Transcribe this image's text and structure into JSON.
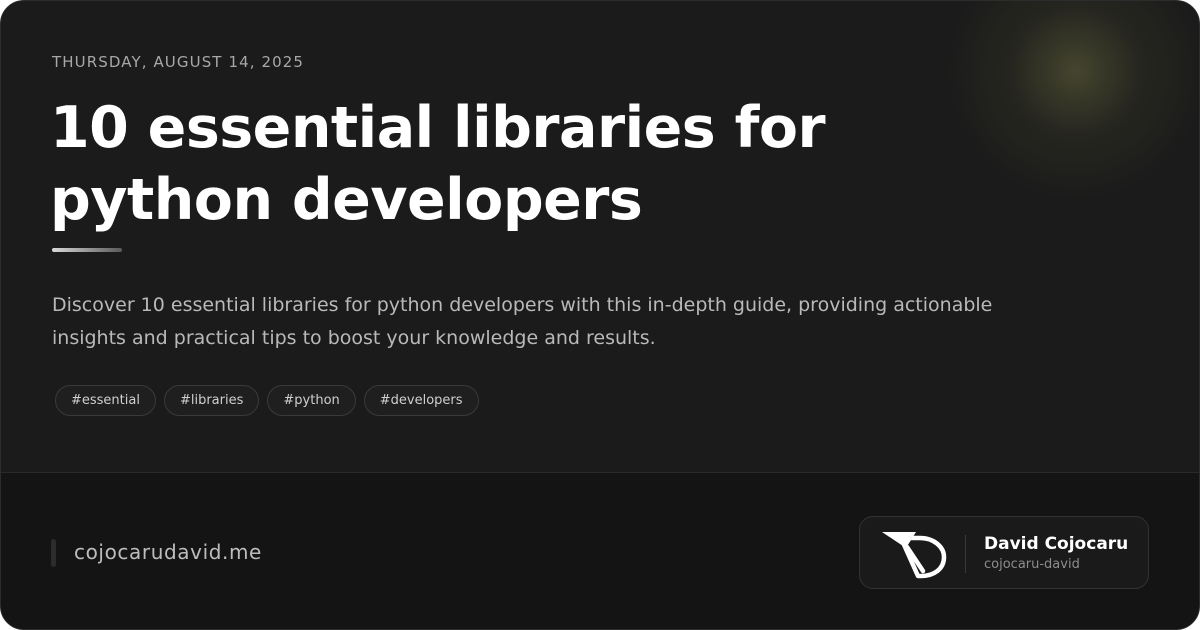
{
  "post": {
    "date": "THURSDAY, AUGUST 14, 2025",
    "title": "10 essential libraries for python developers",
    "description": "Discover 10 essential libraries for python developers with this in-depth guide, providing actionable insights and practical tips to boost your knowledge and results.",
    "tags": [
      "#essential",
      "#libraries",
      "#python",
      "#developers"
    ]
  },
  "footer": {
    "site": "cojocarudavid.me",
    "author": {
      "name": "David Cojocaru",
      "handle": "cojocaru-david",
      "logo_icon": "cd-monogram-logo"
    }
  },
  "colors": {
    "background": "#1b1b1b",
    "footer_background": "#141414",
    "title": "#ffffff",
    "muted_text": "#b9b9b9",
    "glow_accent": "#78784a"
  }
}
